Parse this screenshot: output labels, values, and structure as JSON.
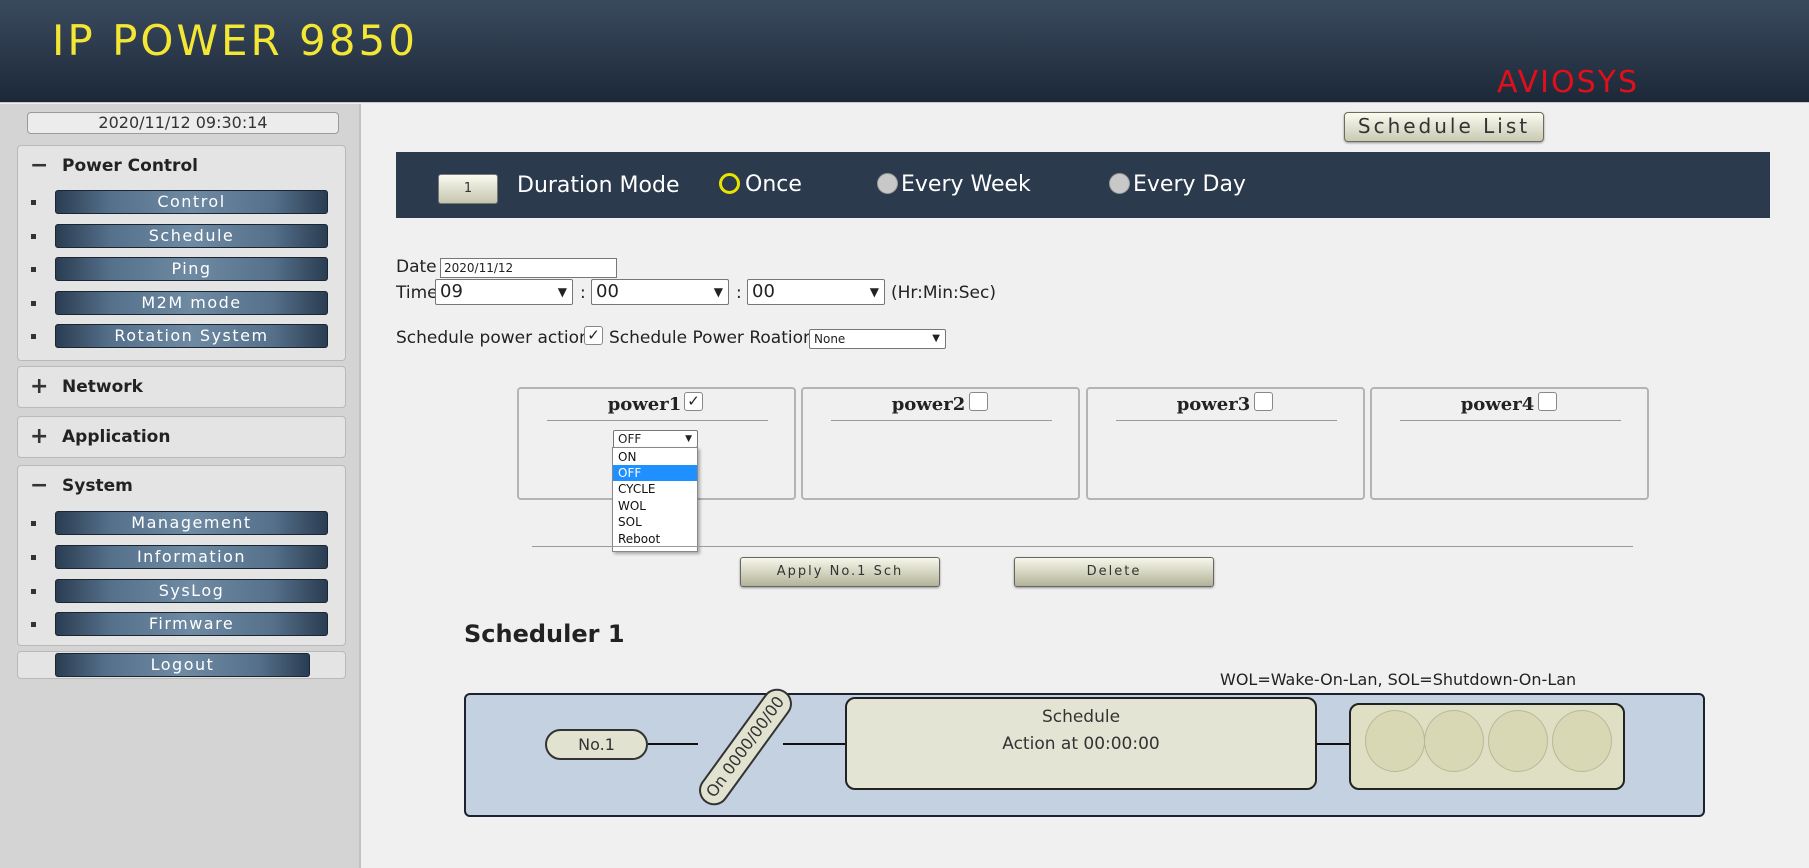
{
  "header": {
    "title": "IP POWER 9850",
    "brand": "AVIOSYS"
  },
  "sidebar": {
    "clock": "2020/11/12 09:30:14",
    "power_control": {
      "sign": "−",
      "title": "Power Control",
      "items": [
        "Control",
        "Schedule",
        "Ping",
        "M2M mode",
        "Rotation System"
      ]
    },
    "network": {
      "sign": "+",
      "title": "Network"
    },
    "application": {
      "sign": "+",
      "title": "Application"
    },
    "system": {
      "sign": "−",
      "title": "System",
      "items": [
        "Management",
        "Information",
        "SysLog",
        "Firmware"
      ]
    },
    "logout": "Logout"
  },
  "main": {
    "schedule_list_label": "Schedule List",
    "mode_bar": {
      "schedule_no": "1",
      "mode_label": "Duration Mode",
      "options": [
        "Once",
        "Every Week",
        "Every Day"
      ],
      "selected": "Once"
    },
    "date": {
      "label": "Date",
      "value": "2020/11/12"
    },
    "time": {
      "label": "Time",
      "hour": "09",
      "minute": "00",
      "second": "00",
      "sep": ":",
      "hint": "(Hr:Min:Sec)"
    },
    "schedule_action_label": "Schedule power action",
    "schedule_action_checked": "✓",
    "rotation_label": "Schedule Power Roation",
    "rotation_value": "None",
    "powers": [
      {
        "name": "power1",
        "checked": "✓"
      },
      {
        "name": "power2",
        "checked": ""
      },
      {
        "name": "power3",
        "checked": ""
      },
      {
        "name": "power4",
        "checked": ""
      }
    ],
    "power1_action": "OFF",
    "action_options": [
      "ON",
      "OFF",
      "CYCLE",
      "WOL",
      "SOL",
      "Reboot"
    ],
    "action_highlighted": "OFF",
    "apply_label": "Apply No.1 Sch",
    "delete_label": "Delete",
    "scheduler_title": "Scheduler 1",
    "legend_note": "WOL=Wake-On-Lan, SOL=Shutdown-On-Lan",
    "diagram": {
      "no_label": "No.1",
      "on_label": "On 0000/00/00",
      "schedule_title": "Schedule",
      "action_text": "Action at 00:00:00"
    }
  }
}
